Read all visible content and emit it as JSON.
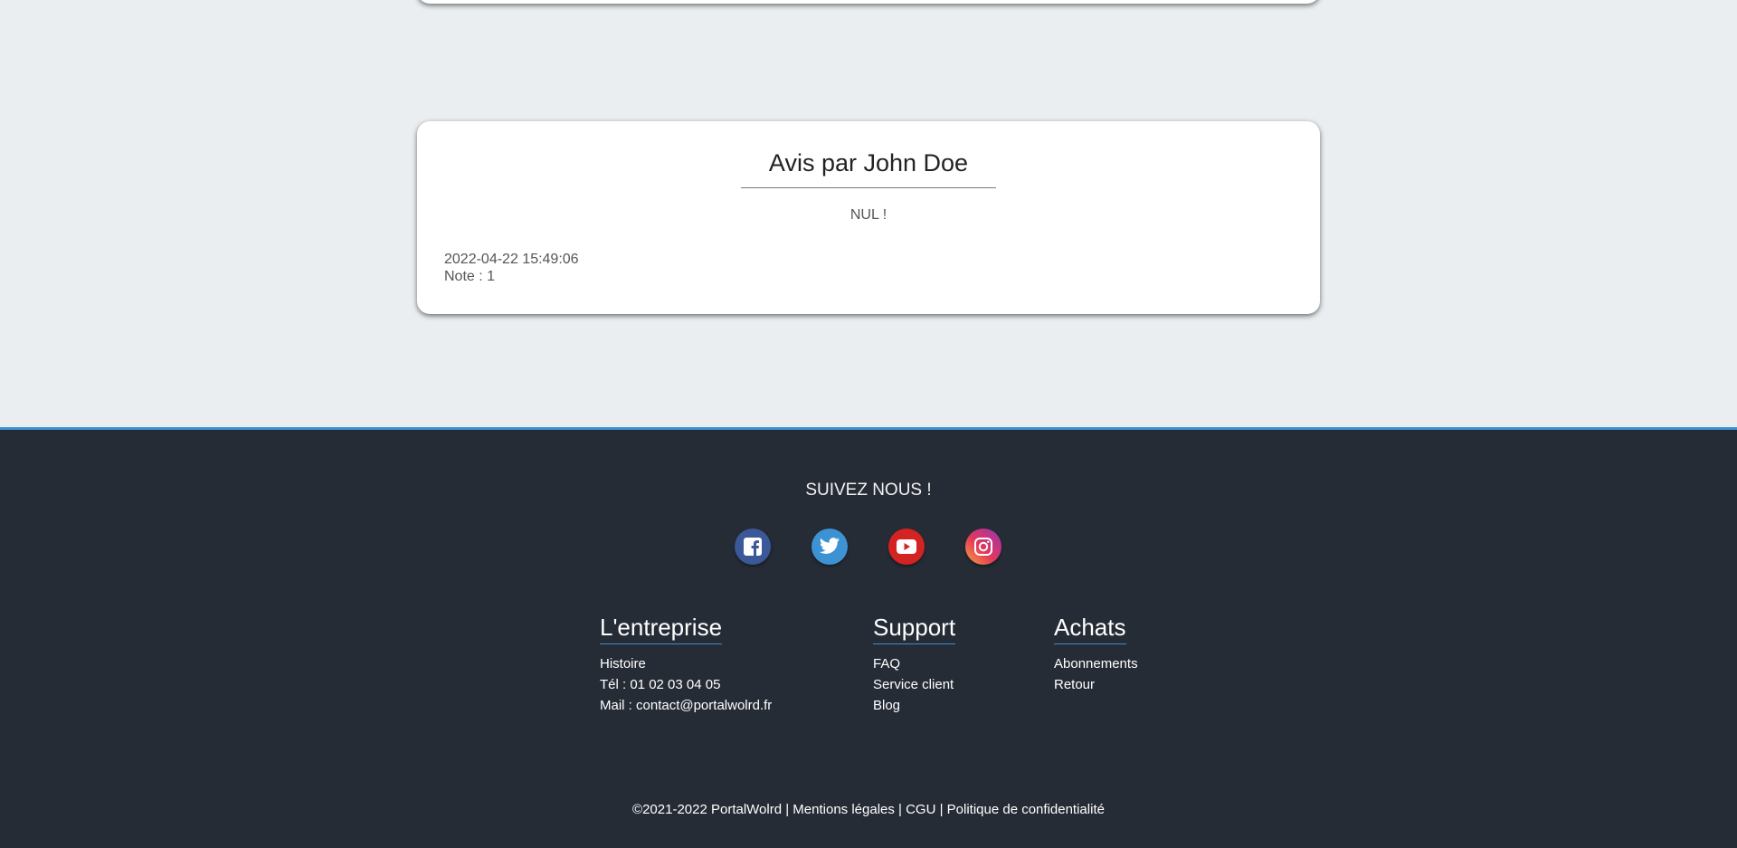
{
  "review": {
    "title": "Avis par John Doe",
    "text": "NUL !",
    "date": "2022-04-22 15:49:06",
    "note": "Note : 1"
  },
  "footer": {
    "follow_title": "SUIVEZ NOUS !",
    "socials": [
      {
        "name": "facebook-icon",
        "color": "#3b5998"
      },
      {
        "name": "twitter-icon",
        "color": "#3d92d4"
      },
      {
        "name": "youtube-icon",
        "color": "#d32323"
      },
      {
        "name": "instagram-icon",
        "color": "#e3375b"
      }
    ],
    "columns": [
      {
        "title": "L'entreprise",
        "items": [
          "Histoire",
          "Tél : 01 02 03 04 05",
          "Mail : contact@portalwolrd.fr"
        ]
      },
      {
        "title": "Support",
        "items": [
          "FAQ",
          "Service client",
          "Blog"
        ]
      },
      {
        "title": "Achats",
        "items": [
          "Abonnements",
          "Retour"
        ]
      }
    ],
    "copyright": "©2021-2022 PortalWolrd | Mentions légales | CGU | Politique de confidentialité"
  },
  "colors": {
    "background": "#eaeef0",
    "footer_bg": "#262c36",
    "accent": "#3b8fd0"
  }
}
